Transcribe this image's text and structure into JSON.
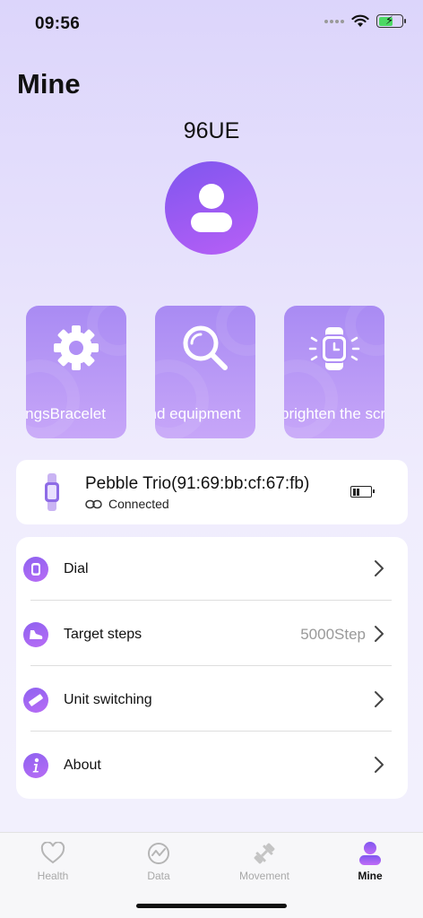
{
  "status_bar": {
    "time": "09:56"
  },
  "header": {
    "title": "Mine",
    "username": "96UE"
  },
  "tiles": [
    {
      "label": "settingsBracelet",
      "icon": "gear-icon"
    },
    {
      "label": "equipmentFind equipment",
      "icon": "search-icon"
    },
    {
      "label": "brighten the screen",
      "icon": "watch-brighten-icon"
    }
  ],
  "device": {
    "name": "Pebble Trio(91:69:bb:cf:67:fb)",
    "status": "Connected",
    "battery_level_percent": 30
  },
  "menu": [
    {
      "label": "Dial",
      "value": "",
      "icon": "watch-dial-icon"
    },
    {
      "label": "Target steps",
      "value": "5000Step",
      "icon": "shoe-icon"
    },
    {
      "label": "Unit switching",
      "value": "",
      "icon": "ruler-icon"
    },
    {
      "label": "About",
      "value": "",
      "icon": "info-icon"
    }
  ],
  "tabs": [
    {
      "label": "Health",
      "icon": "heart-icon",
      "active": false
    },
    {
      "label": "Data",
      "icon": "chart-icon",
      "active": false
    },
    {
      "label": "Movement",
      "icon": "dumbbell-icon",
      "active": false
    },
    {
      "label": "Mine",
      "icon": "person-icon",
      "active": true
    }
  ],
  "colors": {
    "accent": "#8e62f0",
    "tile": "#b797f6",
    "inactive": "#a8a8a8"
  }
}
